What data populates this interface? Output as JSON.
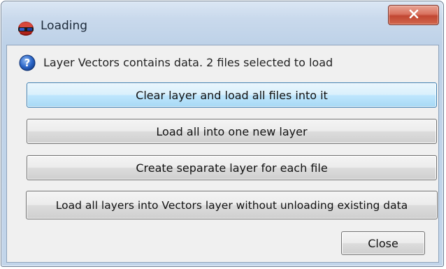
{
  "window": {
    "title": "Loading",
    "icons": {
      "app": "3d-glasses-icon",
      "close": "close-icon",
      "info": "question-icon"
    },
    "colors": {
      "frame": "#c2d5ea",
      "client": "#f0f0f0",
      "close_red": "#c14733",
      "default_blue": "#3c7fb1"
    }
  },
  "message": "Layer Vectors contains data. 2 files selected to load",
  "buttons": {
    "clear_and_load": "Clear layer and load all files into it",
    "load_one_new": "Load all into one new layer",
    "separate_layers": "Create separate layer for each file",
    "load_into_existing": "Load all layers into Vectors layer without unloading existing data",
    "close": "Close"
  }
}
